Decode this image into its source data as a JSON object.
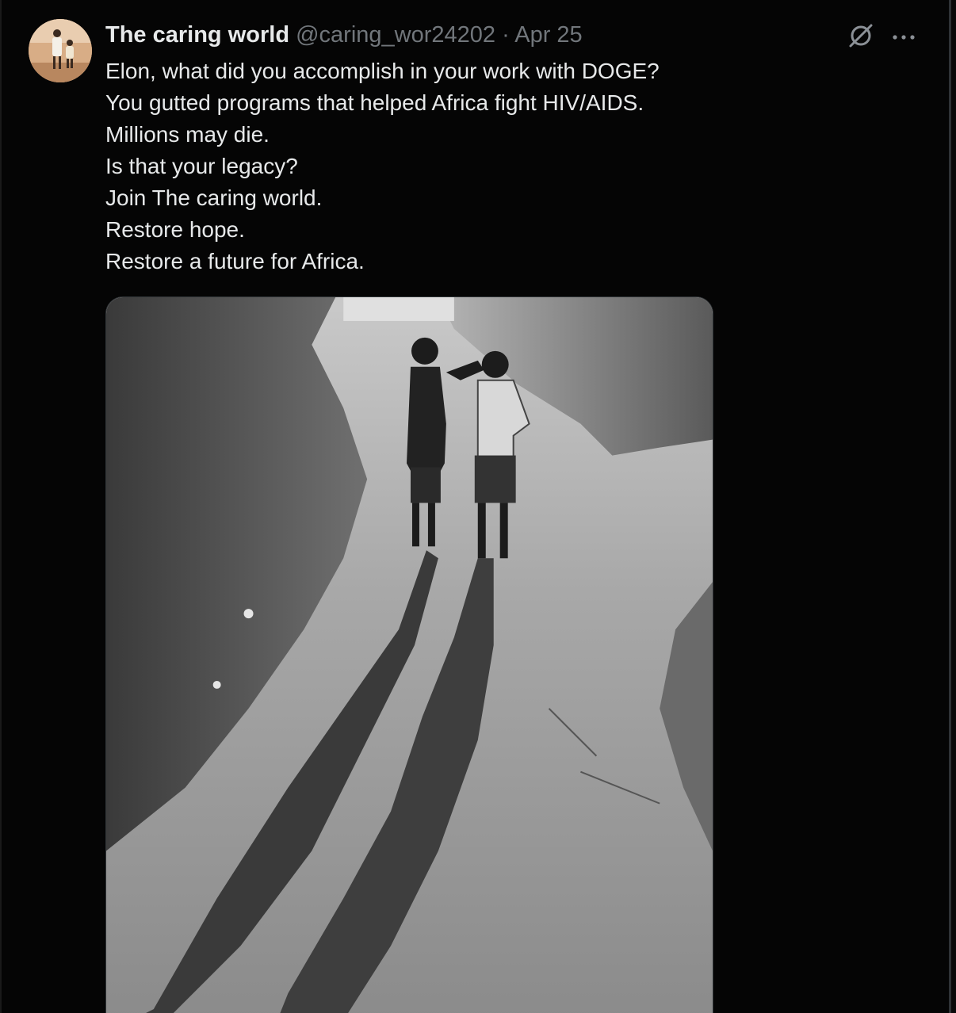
{
  "tweet": {
    "author": {
      "name": "The caring world",
      "handle": "@caring_wor24202",
      "separator": "·",
      "date": "Apr 25",
      "avatar_icon": "profile-photo-children"
    },
    "lines": [
      "Elon, what did you accomplish in your work with DOGE?",
      "You gutted programs that helped Africa fight HIV/AIDS.",
      "Millions may die.",
      "Is that your legacy?",
      "Join The caring world.",
      "Restore hope.",
      "Restore a future for Africa."
    ],
    "actions": {
      "grok_icon": "grok-icon",
      "more_icon": "more-options-icon",
      "more_glyph": "···"
    },
    "media": {
      "type": "photo",
      "subject": "black-and-white photo of two children on a dirt path with long shadows"
    }
  },
  "colors": {
    "background": "#050505",
    "text": "#e7e9ea",
    "secondary_text": "#71767b",
    "border": "#2f3336"
  }
}
